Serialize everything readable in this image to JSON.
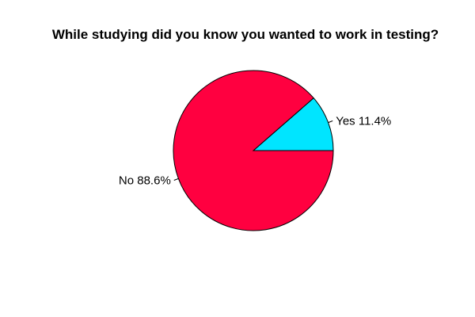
{
  "chart_data": {
    "type": "pie",
    "title": "While studying did you know you wanted to work in testing?",
    "slices": [
      {
        "label": "Yes 11.4%",
        "value": 11.4,
        "color": "#00E5FF"
      },
      {
        "label": "No 88.6%",
        "value": 88.6,
        "color": "#FF0040"
      }
    ],
    "start_angle_deg": 0,
    "direction": "counterclockwise",
    "outline_color": "#000000"
  }
}
